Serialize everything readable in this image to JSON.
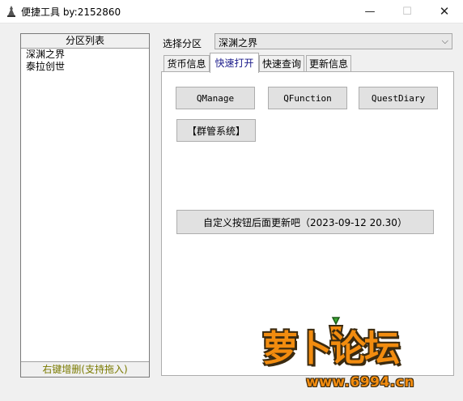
{
  "window": {
    "title": "便捷工具 by:2152860",
    "minimize_icon": "minimize-icon",
    "maximize_icon": "maximize-icon",
    "close_icon": "close-icon"
  },
  "zone_list": {
    "header": "分区列表",
    "items": [
      "深渊之界",
      "泰拉创世"
    ],
    "footer": "右键增删(支持拖入)"
  },
  "zone_select": {
    "label": "选择分区",
    "value": "深渊之界"
  },
  "tabs": [
    {
      "label": "货币信息"
    },
    {
      "label": "快速打开"
    },
    {
      "label": "快速查询"
    },
    {
      "label": "更新信息"
    }
  ],
  "active_tab": "快速打开",
  "buttons": {
    "qmanage": "QManage",
    "qfunction": "QFunction",
    "questdiary": "QuestDiary",
    "group_manage": "【群管系统】",
    "custom": "自定义按钮后面更新吧（2023-09-12 20.30）"
  },
  "watermark": {
    "text": "萝卜论坛",
    "url": "www.6994.cn"
  },
  "colors": {
    "accent_tab_text": "#1a1a8a",
    "footer_text": "#7a7a00",
    "watermark_orange": "#f28c0f"
  }
}
